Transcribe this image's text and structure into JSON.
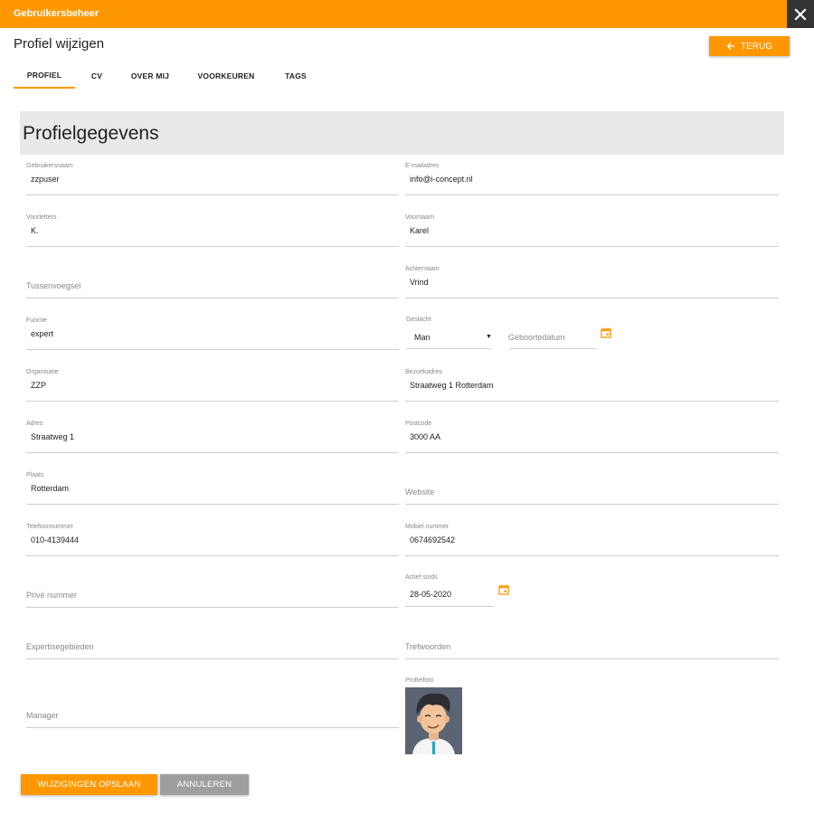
{
  "window": {
    "title": "Gebruikersbeheer",
    "close_icon": "close-icon"
  },
  "page": {
    "title": "Profiel wijzigen",
    "back_label": "TERUG"
  },
  "tabs": [
    {
      "label": "PROFIEL",
      "active": true
    },
    {
      "label": "CV",
      "active": false
    },
    {
      "label": "OVER MIJ",
      "active": false
    },
    {
      "label": "VOORKEUREN",
      "active": false
    },
    {
      "label": "TAGS",
      "active": false
    }
  ],
  "section": {
    "title": "Profielgegevens"
  },
  "fields": {
    "gebruikersnaam": {
      "label": "Gebruikersnaam",
      "value": "zzpuser"
    },
    "emailadres": {
      "label": "E-mailadres",
      "value": "info@i-concept.nl"
    },
    "voorletters": {
      "label": "Voorletters",
      "value": "K."
    },
    "voornaam": {
      "label": "Voornaam",
      "value": "Karel"
    },
    "tussenvoegsel": {
      "placeholder": "Tussenvoegsel"
    },
    "achternaam": {
      "label": "Achternaam",
      "value": "Vrind"
    },
    "functie": {
      "label": "Functie",
      "value": "expert"
    },
    "geslacht": {
      "label": "Geslacht",
      "value": "Man"
    },
    "geboortedatum": {
      "placeholder": "Geboortedatum"
    },
    "organisatie": {
      "label": "Organisatie",
      "value": "ZZP"
    },
    "bezoekadres": {
      "label": "Bezoekadres",
      "value": "Straatweg 1 Rotterdam"
    },
    "adres": {
      "label": "Adres",
      "value": "Straatweg 1"
    },
    "postcode": {
      "label": "Postcode",
      "value": "3000 AA"
    },
    "plaats": {
      "label": "Plaats",
      "value": "Rotterdam"
    },
    "website": {
      "placeholder": "Website"
    },
    "telefoonnummer": {
      "label": "Telefoonnummer",
      "value": "010-4139444"
    },
    "mobiel": {
      "label": "Mobiel nummer",
      "value": "0674692542"
    },
    "prive": {
      "placeholder": "Privé nummer"
    },
    "actief_sinds": {
      "label": "Actief sinds",
      "value": "28-05-2020"
    },
    "expertise": {
      "placeholder": "Expertisegebieden"
    },
    "trefwoorden": {
      "placeholder": "Trefwoorden"
    },
    "manager": {
      "placeholder": "Manager"
    },
    "profielfoto": {
      "label": "Profielfoto"
    }
  },
  "actions": {
    "save_label": "WIJZIGINGEN OPSLAAN",
    "cancel_label": "ANNULEREN"
  },
  "colors": {
    "accent": "#ff9800",
    "cancel": "#9e9e9e",
    "close_bg": "#333333"
  }
}
